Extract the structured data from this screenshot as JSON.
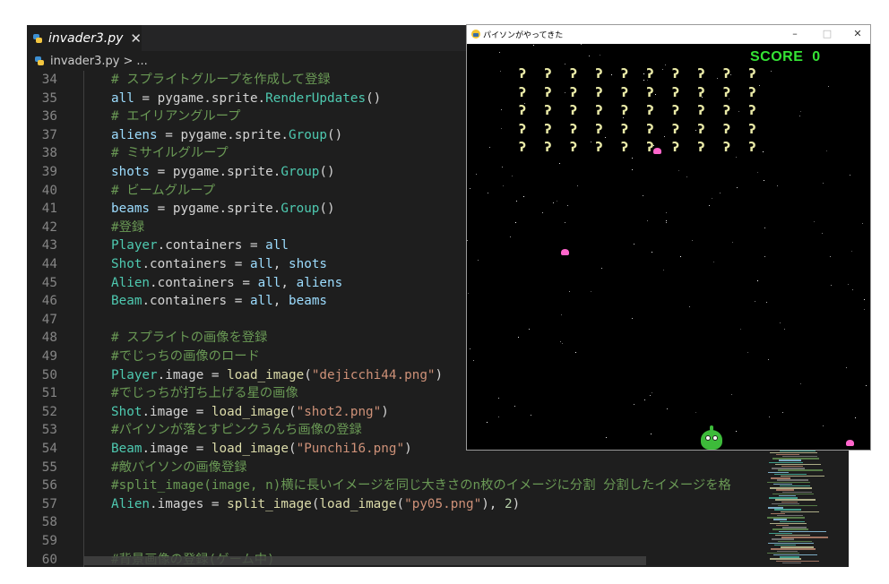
{
  "editor": {
    "tab_label": "invader3.py",
    "tab_close": "✕",
    "breadcrumb_file": "invader3.py",
    "breadcrumb_sep": ">",
    "breadcrumb_more": "...",
    "lines": [
      {
        "n": "34",
        "tokens": [
          {
            "t": "# スプライトグループを作成して登録",
            "c": "comment"
          }
        ]
      },
      {
        "n": "35",
        "tokens": [
          {
            "t": "all",
            "c": "var"
          },
          {
            "t": " = pygame.sprite.",
            "c": ""
          },
          {
            "t": "RenderUpdates",
            "c": "cls"
          },
          {
            "t": "()",
            "c": ""
          }
        ]
      },
      {
        "n": "36",
        "tokens": [
          {
            "t": "# エイリアングループ",
            "c": "comment"
          }
        ]
      },
      {
        "n": "37",
        "tokens": [
          {
            "t": "aliens",
            "c": "var"
          },
          {
            "t": " = pygame.sprite.",
            "c": ""
          },
          {
            "t": "Group",
            "c": "cls"
          },
          {
            "t": "()",
            "c": ""
          }
        ]
      },
      {
        "n": "38",
        "tokens": [
          {
            "t": "# ミサイルグループ",
            "c": "comment"
          }
        ]
      },
      {
        "n": "39",
        "tokens": [
          {
            "t": "shots",
            "c": "var"
          },
          {
            "t": " = pygame.sprite.",
            "c": ""
          },
          {
            "t": "Group",
            "c": "cls"
          },
          {
            "t": "()",
            "c": ""
          }
        ]
      },
      {
        "n": "40",
        "tokens": [
          {
            "t": "# ビームグループ",
            "c": "comment"
          }
        ]
      },
      {
        "n": "41",
        "tokens": [
          {
            "t": "beams",
            "c": "var"
          },
          {
            "t": " = pygame.sprite.",
            "c": ""
          },
          {
            "t": "Group",
            "c": "cls"
          },
          {
            "t": "()",
            "c": ""
          }
        ]
      },
      {
        "n": "42",
        "tokens": [
          {
            "t": "#登録",
            "c": "comment"
          }
        ]
      },
      {
        "n": "43",
        "tokens": [
          {
            "t": "Player",
            "c": "cls"
          },
          {
            "t": ".containers = ",
            "c": ""
          },
          {
            "t": "all",
            "c": "var"
          }
        ]
      },
      {
        "n": "44",
        "tokens": [
          {
            "t": "Shot",
            "c": "cls"
          },
          {
            "t": ".containers = ",
            "c": ""
          },
          {
            "t": "all",
            "c": "var"
          },
          {
            "t": ", ",
            "c": ""
          },
          {
            "t": "shots",
            "c": "var"
          }
        ]
      },
      {
        "n": "45",
        "tokens": [
          {
            "t": "Alien",
            "c": "cls"
          },
          {
            "t": ".containers = ",
            "c": ""
          },
          {
            "t": "all",
            "c": "var"
          },
          {
            "t": ", ",
            "c": ""
          },
          {
            "t": "aliens",
            "c": "var"
          }
        ]
      },
      {
        "n": "46",
        "tokens": [
          {
            "t": "Beam",
            "c": "cls"
          },
          {
            "t": ".containers = ",
            "c": ""
          },
          {
            "t": "all",
            "c": "var"
          },
          {
            "t": ", ",
            "c": ""
          },
          {
            "t": "beams",
            "c": "var"
          }
        ]
      },
      {
        "n": "47",
        "tokens": []
      },
      {
        "n": "48",
        "tokens": [
          {
            "t": "# スプライトの画像を登録",
            "c": "comment"
          }
        ]
      },
      {
        "n": "49",
        "tokens": [
          {
            "t": "#でじっちの画像のロード",
            "c": "comment"
          }
        ]
      },
      {
        "n": "50",
        "tokens": [
          {
            "t": "Player",
            "c": "cls"
          },
          {
            "t": ".image = ",
            "c": ""
          },
          {
            "t": "load_image",
            "c": "fn"
          },
          {
            "t": "(",
            "c": ""
          },
          {
            "t": "\"dejicchi44.png\"",
            "c": "str"
          },
          {
            "t": ")",
            "c": ""
          }
        ]
      },
      {
        "n": "51",
        "tokens": [
          {
            "t": "#でじっちが打ち上げる星の画像",
            "c": "comment"
          }
        ]
      },
      {
        "n": "52",
        "tokens": [
          {
            "t": "Shot",
            "c": "cls"
          },
          {
            "t": ".image = ",
            "c": ""
          },
          {
            "t": "load_image",
            "c": "fn"
          },
          {
            "t": "(",
            "c": ""
          },
          {
            "t": "\"shot2.png\"",
            "c": "str"
          },
          {
            "t": ")",
            "c": ""
          }
        ]
      },
      {
        "n": "53",
        "tokens": [
          {
            "t": "#パイソンが落とすピンクうんち画像の登録",
            "c": "comment"
          }
        ]
      },
      {
        "n": "54",
        "tokens": [
          {
            "t": "Beam",
            "c": "cls"
          },
          {
            "t": ".image = ",
            "c": ""
          },
          {
            "t": "load_image",
            "c": "fn"
          },
          {
            "t": "(",
            "c": ""
          },
          {
            "t": "\"Punchi16.png\"",
            "c": "str"
          },
          {
            "t": ")",
            "c": ""
          }
        ]
      },
      {
        "n": "55",
        "tokens": [
          {
            "t": "#敵パイソンの画像登録",
            "c": "comment"
          }
        ]
      },
      {
        "n": "56",
        "tokens": [
          {
            "t": "#split_image(image, n)横に長いイメージを同じ大きさのn枚のイメージに分割 分割したイメージを格",
            "c": "comment"
          }
        ]
      },
      {
        "n": "57",
        "tokens": [
          {
            "t": "Alien",
            "c": "cls"
          },
          {
            "t": ".images = ",
            "c": ""
          },
          {
            "t": "split_image",
            "c": "fn"
          },
          {
            "t": "(",
            "c": ""
          },
          {
            "t": "load_image",
            "c": "fn"
          },
          {
            "t": "(",
            "c": ""
          },
          {
            "t": "\"py05.png\"",
            "c": "str"
          },
          {
            "t": "), ",
            "c": ""
          },
          {
            "t": "2",
            "c": "num"
          },
          {
            "t": ")",
            "c": ""
          }
        ]
      },
      {
        "n": "58",
        "tokens": []
      },
      {
        "n": "59",
        "tokens": []
      },
      {
        "n": "60",
        "tokens": [
          {
            "t": "#背景画像の登録(ゲーム中)",
            "c": "comment"
          }
        ]
      }
    ]
  },
  "game": {
    "window_title": "パイソンがやってきた",
    "minimize": "–",
    "maximize": "□",
    "close": "✕",
    "score_label": "SCORE",
    "score_value": "0",
    "alien_rows": 5,
    "alien_cols": 10,
    "alien_glyph": "ʔ",
    "colors": {
      "score": "#35e335",
      "alien": "#e9e9a6",
      "beam": "#ff66cc",
      "player": "#3dbb3a",
      "background": "#000000"
    }
  }
}
